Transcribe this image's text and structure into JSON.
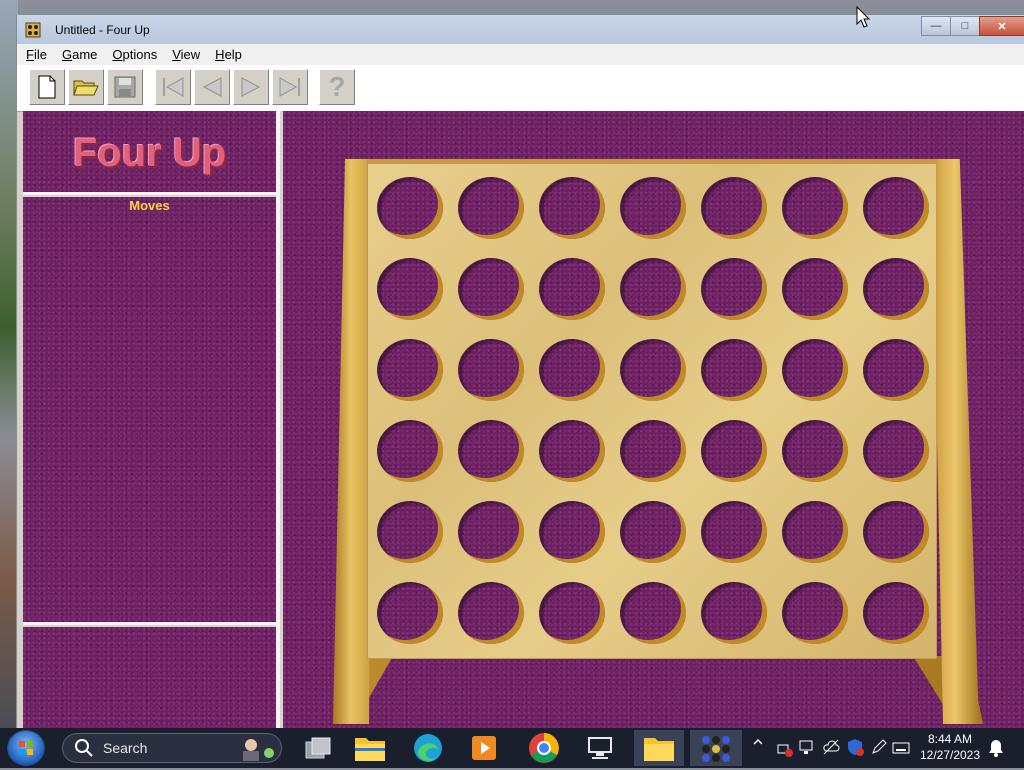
{
  "window": {
    "title": "Untitled - Four Up",
    "controls": {
      "minimize": "—",
      "maximize": "□",
      "close": "✕"
    }
  },
  "menubar": {
    "items": [
      {
        "accel": "F",
        "rest": "ile"
      },
      {
        "accel": "G",
        "rest": "ame"
      },
      {
        "accel": "O",
        "rest": "ptions"
      },
      {
        "accel": "V",
        "rest": "iew"
      },
      {
        "accel": "H",
        "rest": "elp"
      }
    ]
  },
  "toolbar": {
    "buttons": [
      "new-file-icon",
      "open-folder-icon",
      "save-icon",
      "first-move-icon",
      "previous-move-icon",
      "next-move-icon",
      "last-move-icon",
      "help-icon"
    ],
    "help_glyph": "?"
  },
  "sidepanel": {
    "logo": "Four Up",
    "moves_label": "Moves",
    "moves": []
  },
  "board": {
    "rows": 6,
    "columns": 7,
    "cells": [
      [
        "",
        "",
        "",
        "",
        "",
        "",
        ""
      ],
      [
        "",
        "",
        "",
        "",
        "",
        "",
        ""
      ],
      [
        "",
        "",
        "",
        "",
        "",
        "",
        ""
      ],
      [
        "",
        "",
        "",
        "",
        "",
        "",
        ""
      ],
      [
        "",
        "",
        "",
        "",
        "",
        "",
        ""
      ],
      [
        "",
        "",
        "",
        "",
        "",
        "",
        ""
      ]
    ],
    "colors": {
      "felt": "#6e1f63",
      "wood": "#e0c784"
    }
  },
  "taskbar": {
    "search_placeholder": "Search",
    "apps": [
      "task-view-icon",
      "file-explorer-icon",
      "edge-icon",
      "media-player-icon",
      "chrome-icon",
      "remote-desktop-icon",
      "folder-icon",
      "four-up-app-icon"
    ],
    "clock": {
      "time": "8:44 AM",
      "date": "12/27/2023"
    }
  }
}
